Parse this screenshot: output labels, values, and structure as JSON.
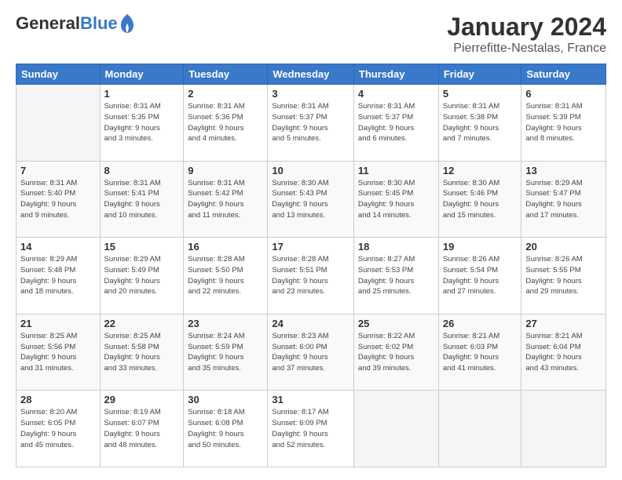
{
  "logo": {
    "general": "General",
    "blue": "Blue"
  },
  "header": {
    "month": "January 2024",
    "location": "Pierrefitte-Nestalas, France"
  },
  "weekdays": [
    "Sunday",
    "Monday",
    "Tuesday",
    "Wednesday",
    "Thursday",
    "Friday",
    "Saturday"
  ],
  "weeks": [
    [
      {
        "day": "",
        "info": ""
      },
      {
        "day": "1",
        "info": "Sunrise: 8:31 AM\nSunset: 5:35 PM\nDaylight: 9 hours\nand 3 minutes."
      },
      {
        "day": "2",
        "info": "Sunrise: 8:31 AM\nSunset: 5:36 PM\nDaylight: 9 hours\nand 4 minutes."
      },
      {
        "day": "3",
        "info": "Sunrise: 8:31 AM\nSunset: 5:37 PM\nDaylight: 9 hours\nand 5 minutes."
      },
      {
        "day": "4",
        "info": "Sunrise: 8:31 AM\nSunset: 5:37 PM\nDaylight: 9 hours\nand 6 minutes."
      },
      {
        "day": "5",
        "info": "Sunrise: 8:31 AM\nSunset: 5:38 PM\nDaylight: 9 hours\nand 7 minutes."
      },
      {
        "day": "6",
        "info": "Sunrise: 8:31 AM\nSunset: 5:39 PM\nDaylight: 9 hours\nand 8 minutes."
      }
    ],
    [
      {
        "day": "7",
        "info": "Sunrise: 8:31 AM\nSunset: 5:40 PM\nDaylight: 9 hours\nand 9 minutes."
      },
      {
        "day": "8",
        "info": "Sunrise: 8:31 AM\nSunset: 5:41 PM\nDaylight: 9 hours\nand 10 minutes."
      },
      {
        "day": "9",
        "info": "Sunrise: 8:31 AM\nSunset: 5:42 PM\nDaylight: 9 hours\nand 11 minutes."
      },
      {
        "day": "10",
        "info": "Sunrise: 8:30 AM\nSunset: 5:43 PM\nDaylight: 9 hours\nand 13 minutes."
      },
      {
        "day": "11",
        "info": "Sunrise: 8:30 AM\nSunset: 5:45 PM\nDaylight: 9 hours\nand 14 minutes."
      },
      {
        "day": "12",
        "info": "Sunrise: 8:30 AM\nSunset: 5:46 PM\nDaylight: 9 hours\nand 15 minutes."
      },
      {
        "day": "13",
        "info": "Sunrise: 8:29 AM\nSunset: 5:47 PM\nDaylight: 9 hours\nand 17 minutes."
      }
    ],
    [
      {
        "day": "14",
        "info": "Sunrise: 8:29 AM\nSunset: 5:48 PM\nDaylight: 9 hours\nand 18 minutes."
      },
      {
        "day": "15",
        "info": "Sunrise: 8:29 AM\nSunset: 5:49 PM\nDaylight: 9 hours\nand 20 minutes."
      },
      {
        "day": "16",
        "info": "Sunrise: 8:28 AM\nSunset: 5:50 PM\nDaylight: 9 hours\nand 22 minutes."
      },
      {
        "day": "17",
        "info": "Sunrise: 8:28 AM\nSunset: 5:51 PM\nDaylight: 9 hours\nand 23 minutes."
      },
      {
        "day": "18",
        "info": "Sunrise: 8:27 AM\nSunset: 5:53 PM\nDaylight: 9 hours\nand 25 minutes."
      },
      {
        "day": "19",
        "info": "Sunrise: 8:26 AM\nSunset: 5:54 PM\nDaylight: 9 hours\nand 27 minutes."
      },
      {
        "day": "20",
        "info": "Sunrise: 8:26 AM\nSunset: 5:55 PM\nDaylight: 9 hours\nand 29 minutes."
      }
    ],
    [
      {
        "day": "21",
        "info": "Sunrise: 8:25 AM\nSunset: 5:56 PM\nDaylight: 9 hours\nand 31 minutes."
      },
      {
        "day": "22",
        "info": "Sunrise: 8:25 AM\nSunset: 5:58 PM\nDaylight: 9 hours\nand 33 minutes."
      },
      {
        "day": "23",
        "info": "Sunrise: 8:24 AM\nSunset: 5:59 PM\nDaylight: 9 hours\nand 35 minutes."
      },
      {
        "day": "24",
        "info": "Sunrise: 8:23 AM\nSunset: 6:00 PM\nDaylight: 9 hours\nand 37 minutes."
      },
      {
        "day": "25",
        "info": "Sunrise: 8:22 AM\nSunset: 6:02 PM\nDaylight: 9 hours\nand 39 minutes."
      },
      {
        "day": "26",
        "info": "Sunrise: 8:21 AM\nSunset: 6:03 PM\nDaylight: 9 hours\nand 41 minutes."
      },
      {
        "day": "27",
        "info": "Sunrise: 8:21 AM\nSunset: 6:04 PM\nDaylight: 9 hours\nand 43 minutes."
      }
    ],
    [
      {
        "day": "28",
        "info": "Sunrise: 8:20 AM\nSunset: 6:05 PM\nDaylight: 9 hours\nand 45 minutes."
      },
      {
        "day": "29",
        "info": "Sunrise: 8:19 AM\nSunset: 6:07 PM\nDaylight: 9 hours\nand 48 minutes."
      },
      {
        "day": "30",
        "info": "Sunrise: 8:18 AM\nSunset: 6:08 PM\nDaylight: 9 hours\nand 50 minutes."
      },
      {
        "day": "31",
        "info": "Sunrise: 8:17 AM\nSunset: 6:09 PM\nDaylight: 9 hours\nand 52 minutes."
      },
      {
        "day": "",
        "info": ""
      },
      {
        "day": "",
        "info": ""
      },
      {
        "day": "",
        "info": ""
      }
    ]
  ]
}
